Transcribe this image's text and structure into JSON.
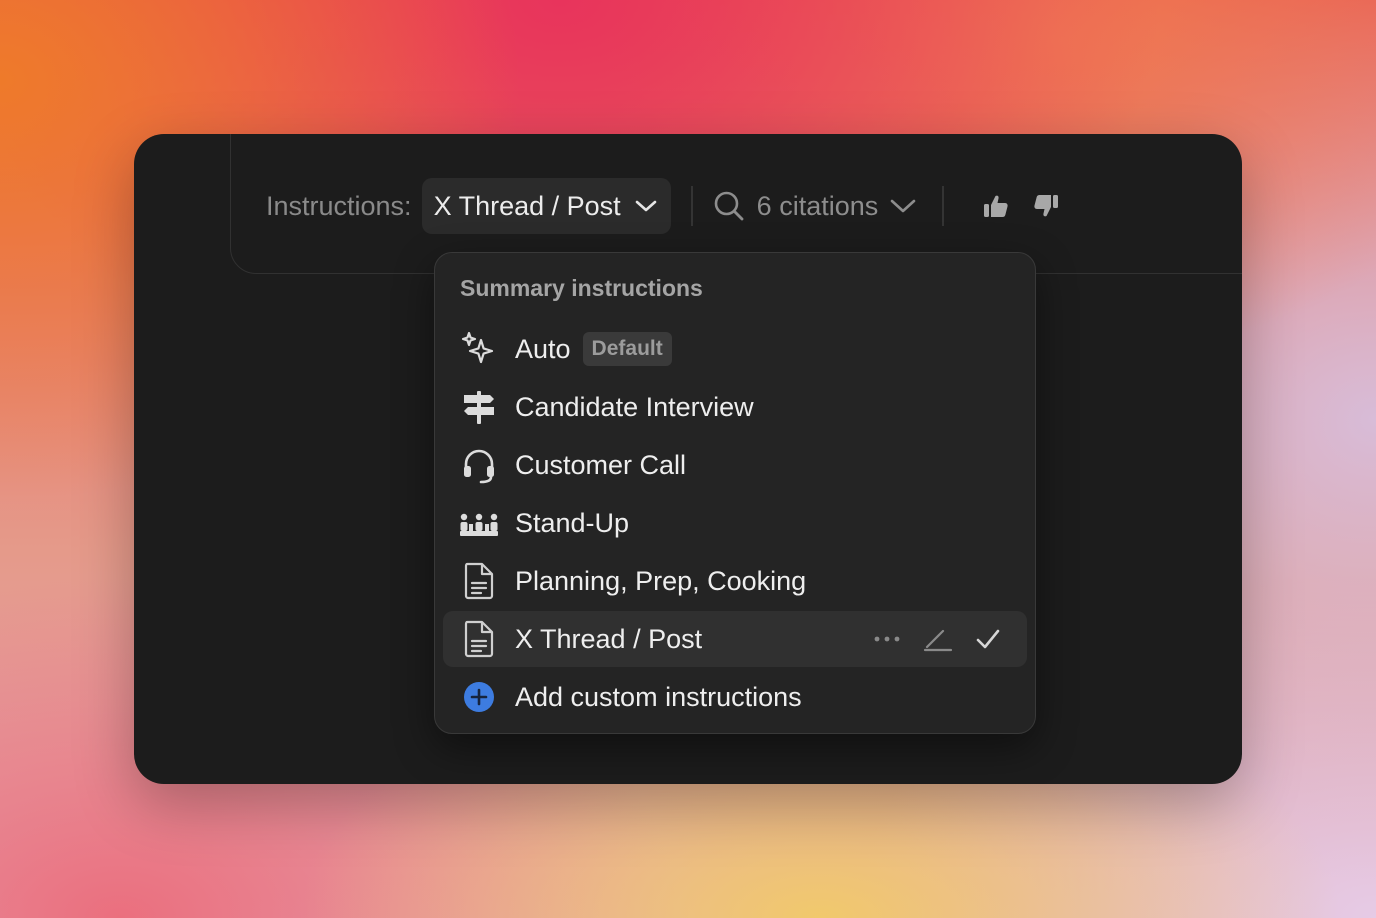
{
  "toolbar": {
    "instructions_label": "Instructions:",
    "selected_instruction": "X Thread / Post",
    "citations_label": "6 citations"
  },
  "menu": {
    "title": "Summary instructions",
    "items": [
      {
        "label": "Auto",
        "icon": "sparkles-icon",
        "badge": "Default"
      },
      {
        "label": "Candidate Interview",
        "icon": "signpost-icon"
      },
      {
        "label": "Customer Call",
        "icon": "headset-icon"
      },
      {
        "label": "Stand-Up",
        "icon": "team-icon"
      },
      {
        "label": "Planning, Prep, Cooking",
        "icon": "document-icon"
      },
      {
        "label": "X Thread / Post",
        "icon": "document-icon",
        "selected": true
      },
      {
        "label": "Add custom instructions",
        "icon": "plus-circle-icon"
      }
    ]
  },
  "colors": {
    "card_bg": "#1c1c1c",
    "menu_bg": "#242424",
    "selected_bg": "#303030",
    "accent_blue": "#3d7ce0",
    "text_primary": "#eeeeee",
    "text_muted": "#8a8a8a"
  }
}
